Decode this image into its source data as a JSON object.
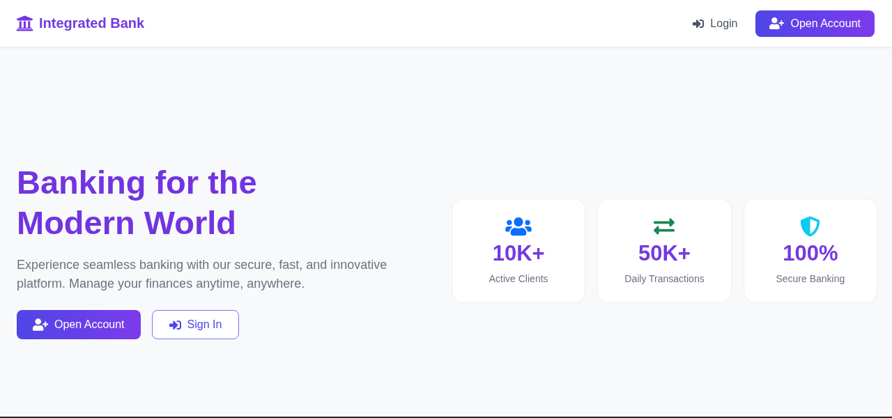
{
  "navbar": {
    "brand": "Integrated Bank",
    "actions": [
      {
        "kind": "link",
        "label": "Login"
      },
      {
        "kind": "primary",
        "label": "Open Account"
      }
    ]
  },
  "hero": {
    "title": "Banking for the Modern World",
    "description": "Experience seamless banking with our secure, fast, and innovative platform. Manage your finances anytime, anywhere.",
    "buttons": [
      {
        "kind": "primary",
        "label": "Open Account"
      },
      {
        "kind": "outline",
        "label": "Sign In"
      }
    ]
  },
  "stats": [
    {
      "value": "10K+",
      "label": "Active Clients",
      "color": "#0d6efd"
    },
    {
      "value": "50K+",
      "label": "Daily Transactions",
      "color": "#198754"
    },
    {
      "value": "100%",
      "label": "Secure Banking",
      "color": "#0dcaf0"
    }
  ]
}
